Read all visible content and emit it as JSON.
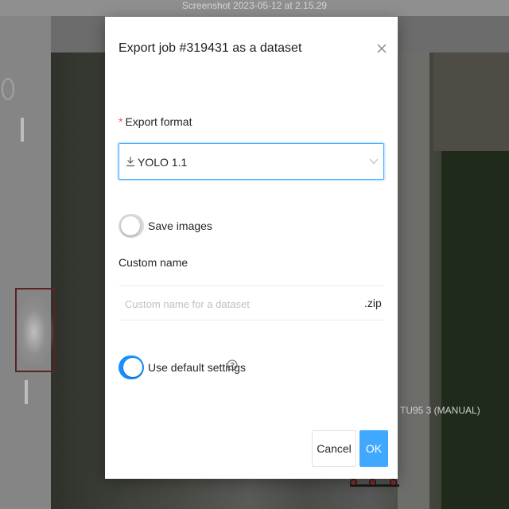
{
  "background": {
    "window_title": "Screenshot 2023-05-12 at 2.15.29",
    "track_label": "TU95 3 (MANUAL)"
  },
  "modal": {
    "title": "Export job #319431 as a dataset",
    "close_icon": "close-icon",
    "export_format": {
      "label": "Export format",
      "required_mark": "*",
      "selected_value": "YOLO 1.1",
      "leading_icon": "download-icon",
      "trailing_icon": "chevron-down-icon"
    },
    "save_images": {
      "label": "Save images",
      "checked": false
    },
    "custom_name": {
      "label": "Custom name",
      "value": "",
      "placeholder": "Custom name for a dataset",
      "suffix": ".zip"
    },
    "use_default_settings": {
      "label": "Use default settings",
      "checked": true,
      "help_icon": "question-circle-icon"
    },
    "buttons": {
      "cancel": "Cancel",
      "ok": "OK"
    }
  },
  "colors": {
    "primary": "#1890ff",
    "ok_button": "#40a9ff",
    "required": "#ff4d4f",
    "switch_off": "#d9d9d9"
  }
}
